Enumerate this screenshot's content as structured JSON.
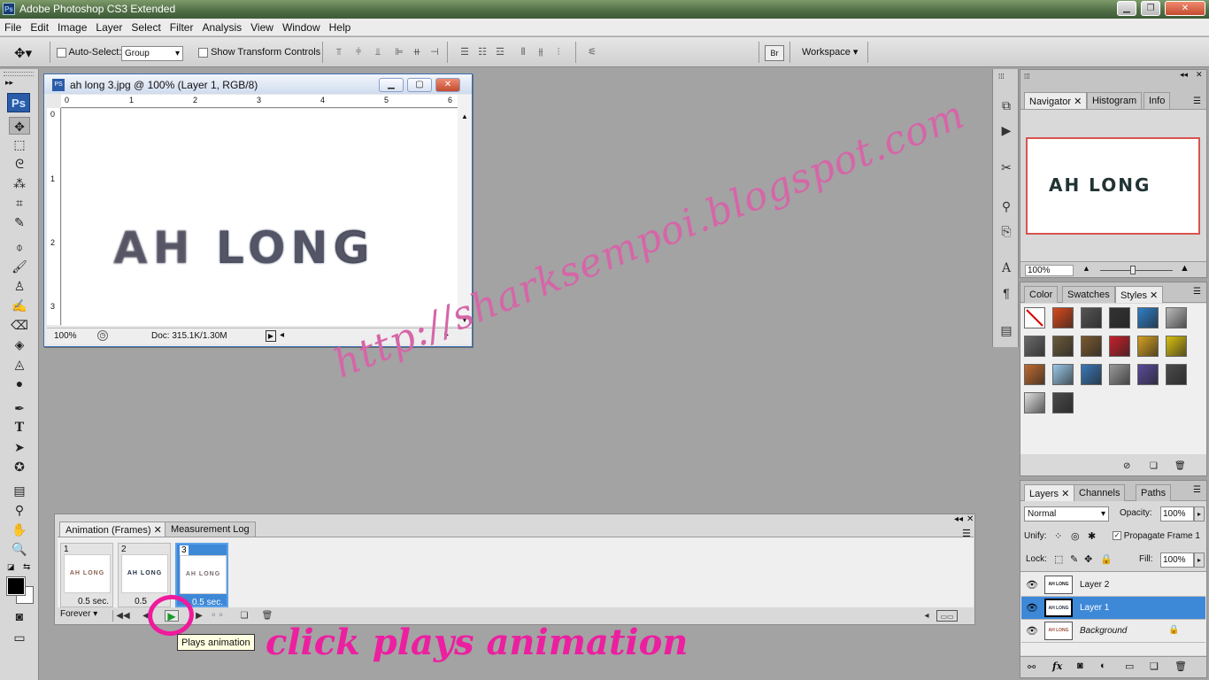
{
  "window": {
    "title": "Adobe Photoshop CS3 Extended",
    "ps_badge": "Ps"
  },
  "menu": [
    "File",
    "Edit",
    "Image",
    "Layer",
    "Select",
    "Filter",
    "Analysis",
    "View",
    "Window",
    "Help"
  ],
  "options": {
    "auto_select_label": "Auto-Select:",
    "auto_select_value": "Group",
    "show_transform_label": "Show Transform Controls",
    "workspace_label": "Workspace"
  },
  "toolbox": {
    "logo": "Ps"
  },
  "document": {
    "title": "ah long 3.jpg @ 100% (Layer 1, RGB/8)",
    "canvas_text_1": "AH",
    "canvas_text_2": "LONG",
    "zoom": "100%",
    "doc_size": "Doc: 315.1K/1.30M",
    "ruler_h": [
      "0",
      "1",
      "2",
      "3",
      "4",
      "5",
      "6"
    ],
    "ruler_v": [
      "0",
      "1",
      "2",
      "3"
    ]
  },
  "watermark": "http://sharksempoi.blogspot.com",
  "annotation": "click plays animation",
  "animation_panel": {
    "tabs": [
      "Animation (Frames)",
      "Measurement Log"
    ],
    "frames": [
      {
        "num": "1",
        "thumb": "AH LONG",
        "delay": "0.5 sec."
      },
      {
        "num": "2",
        "thumb": "AH LONG",
        "delay": "0.5"
      },
      {
        "num": "3",
        "thumb": "AH LONG",
        "delay": "0.5 sec."
      }
    ],
    "loop": "Forever",
    "tooltip": "Plays animation"
  },
  "navigator": {
    "tabs": [
      "Navigator",
      "Histogram",
      "Info"
    ],
    "preview_text": "AH LONG",
    "zoom": "100%"
  },
  "styles_panel": {
    "tabs": [
      "Color",
      "Swatches",
      "Styles"
    ]
  },
  "style_swatches": [
    "#ffffff",
    "#d94a1c",
    "#555555",
    "#333333",
    "#2f7fc8",
    "#bbbbbb",
    "#6a6a6a",
    "#6b5a3a",
    "#7a5a30",
    "#c8202a",
    "#d4a020",
    "#d8c010",
    "#c06a30",
    "#9ac8e8",
    "#3a78b8",
    "#9a9a9a",
    "#5a4a9a",
    "#4a4a4a",
    "#e0e0e0",
    "#4a4a4a"
  ],
  "layers_panel": {
    "tabs": [
      "Layers",
      "Channels",
      "Paths"
    ],
    "blend_mode": "Normal",
    "opacity_label": "Opacity:",
    "opacity": "100%",
    "unify_label": "Unify:",
    "propagate_label": "Propagate Frame 1",
    "lock_label": "Lock:",
    "fill_label": "Fill:",
    "fill": "100%",
    "layers": [
      {
        "name": "Layer 2",
        "thumb": "AH LONG"
      },
      {
        "name": "Layer 1",
        "thumb": "AH LONG"
      },
      {
        "name": "Background",
        "thumb": "AH LONG"
      }
    ]
  }
}
